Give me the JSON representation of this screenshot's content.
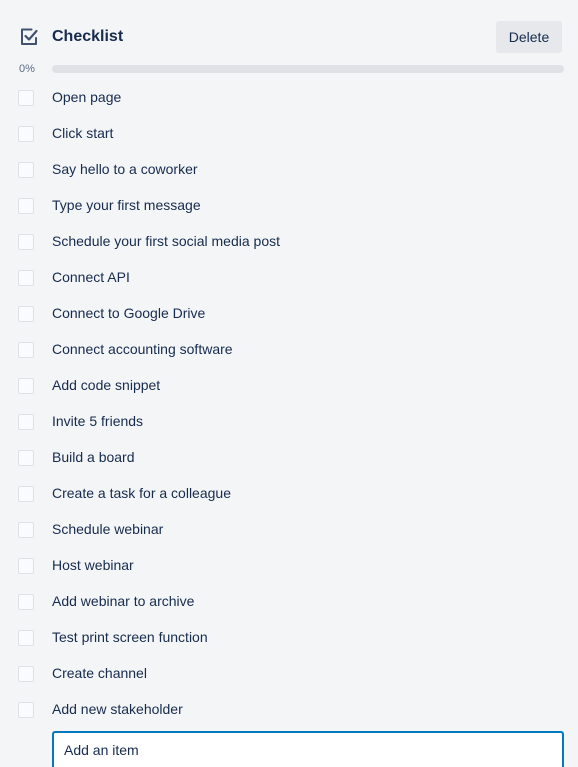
{
  "header": {
    "icon": "checklist-icon",
    "title": "Checklist",
    "delete_label": "Delete"
  },
  "progress": {
    "label": "0%",
    "value": 0
  },
  "items": [
    {
      "label": "Open page",
      "checked": false
    },
    {
      "label": "Click start",
      "checked": false
    },
    {
      "label": "Say hello to a coworker",
      "checked": false
    },
    {
      "label": "Type your first message",
      "checked": false
    },
    {
      "label": "Schedule your first social media post",
      "checked": false
    },
    {
      "label": "Connect API",
      "checked": false
    },
    {
      "label": "Connect to Google Drive",
      "checked": false
    },
    {
      "label": "Connect accounting software",
      "checked": false
    },
    {
      "label": "Add code snippet",
      "checked": false
    },
    {
      "label": "Invite 5 friends",
      "checked": false
    },
    {
      "label": "Build a board",
      "checked": false
    },
    {
      "label": "Create a task for a colleague",
      "checked": false
    },
    {
      "label": "Schedule webinar",
      "checked": false
    },
    {
      "label": "Host webinar",
      "checked": false
    },
    {
      "label": "Add webinar to archive",
      "checked": false
    },
    {
      "label": "Test print screen function",
      "checked": false
    },
    {
      "label": "Create channel",
      "checked": false
    },
    {
      "label": "Add new stakeholder",
      "checked": false
    }
  ],
  "add_item": {
    "placeholder": "Add an item",
    "value": ""
  },
  "colors": {
    "background": "#f4f5f7",
    "text": "#172b4d",
    "muted": "#5e6c84",
    "accent": "#0079bf",
    "progress_track": "#dfe1e6",
    "button_bg": "#e6e8eb"
  }
}
